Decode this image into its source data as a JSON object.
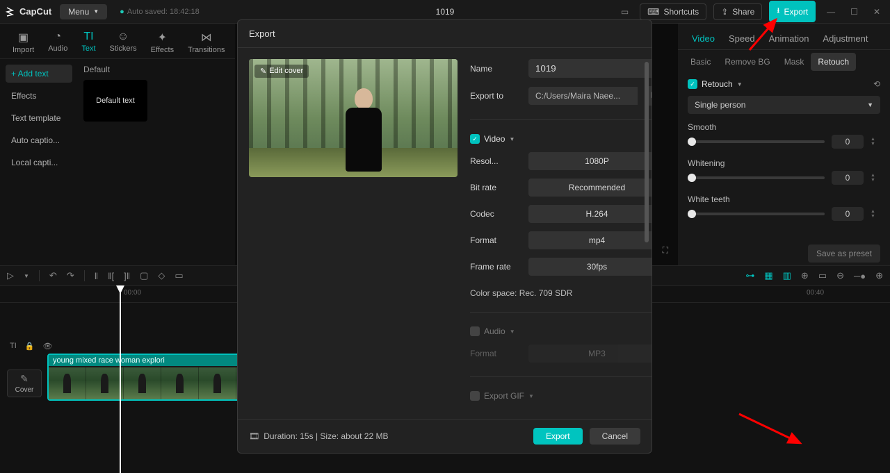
{
  "topbar": {
    "brand": "CapCut",
    "menu": "Menu",
    "autosave_label": "Auto saved: 18:42:18",
    "project_title": "1019",
    "shortcuts": "Shortcuts",
    "share": "Share",
    "export": "Export"
  },
  "media_tabs": {
    "import": "Import",
    "audio": "Audio",
    "text": "Text",
    "stickers": "Stickers",
    "effects": "Effects",
    "transitions": "Transitions"
  },
  "text_side": {
    "add_text": "+ Add text",
    "effects": "Effects",
    "text_template": "Text template",
    "auto_captions": "Auto captio...",
    "local_captions": "Local capti..."
  },
  "media_content": {
    "default_label": "Default",
    "default_thumb": "Default text"
  },
  "inspector": {
    "tabs": {
      "video": "Video",
      "speed": "Speed",
      "animation": "Animation",
      "adjustment": "Adjustment"
    },
    "subtabs": {
      "basic": "Basic",
      "remove_bg": "Remove BG",
      "mask": "Mask",
      "retouch": "Retouch"
    },
    "retouch_label": "Retouch",
    "person_mode": "Single person",
    "smooth_label": "Smooth",
    "smooth_val": "0",
    "whitening_label": "Whitening",
    "whitening_val": "0",
    "teeth_label": "White teeth",
    "teeth_val": "0",
    "save_preset": "Save as preset"
  },
  "timeline": {
    "time0": "00:00",
    "time40": "00:40",
    "cover": "Cover",
    "clip_label": "young mixed race woman explori"
  },
  "modal": {
    "title": "Export",
    "edit_cover": "Edit cover",
    "name_label": "Name",
    "name_value": "1019",
    "exportto_label": "Export to",
    "exportto_path": "C:/Users/Maira Naee...",
    "video_section": "Video",
    "res_label": "Resol...",
    "res_value": "1080P",
    "bitrate_label": "Bit rate",
    "bitrate_value": "Recommended",
    "codec_label": "Codec",
    "codec_value": "H.264",
    "format_label": "Format",
    "format_value": "mp4",
    "fps_label": "Frame rate",
    "fps_value": "30fps",
    "colorspace": "Color space: Rec. 709 SDR",
    "audio_section": "Audio",
    "audio_format_label": "Format",
    "audio_format_value": "MP3",
    "gif_section": "Export GIF",
    "footer_info": "Duration: 15s | Size: about 22 MB",
    "export_btn": "Export",
    "cancel_btn": "Cancel"
  }
}
